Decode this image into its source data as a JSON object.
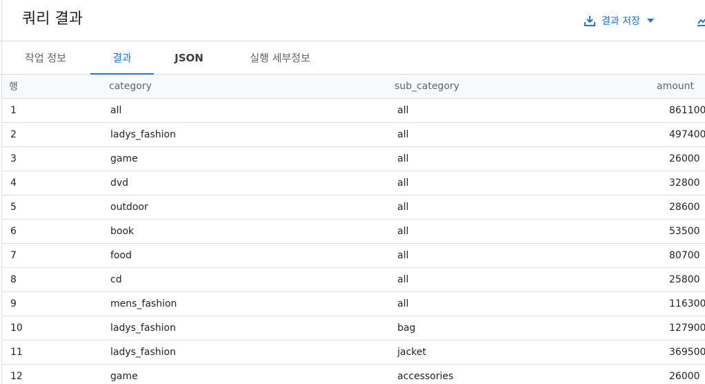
{
  "header": {
    "title": "쿼리 결과",
    "save_results_label": "결과 저장",
    "icons": {
      "save": "download-icon",
      "dropdown": "caret-down-icon",
      "explore": "explore-chart-icon"
    }
  },
  "tabs": [
    {
      "label": "작업 정보",
      "active": false
    },
    {
      "label": "결과",
      "active": true
    },
    {
      "label": "JSON",
      "active": false
    },
    {
      "label": "실행 세부정보",
      "active": false
    }
  ],
  "table": {
    "columns": [
      "행",
      "category",
      "sub_category",
      "amount"
    ],
    "rows": [
      [
        "1",
        "all",
        "all",
        "861100"
      ],
      [
        "2",
        "ladys_fashion",
        "all",
        "497400"
      ],
      [
        "3",
        "game",
        "all",
        "26000"
      ],
      [
        "4",
        "dvd",
        "all",
        "32800"
      ],
      [
        "5",
        "outdoor",
        "all",
        "28600"
      ],
      [
        "6",
        "book",
        "all",
        "53500"
      ],
      [
        "7",
        "food",
        "all",
        "80700"
      ],
      [
        "8",
        "cd",
        "all",
        "25800"
      ],
      [
        "9",
        "mens_fashion",
        "all",
        "116300"
      ],
      [
        "10",
        "ladys_fashion",
        "bag",
        "127900"
      ],
      [
        "11",
        "ladys_fashion",
        "jacket",
        "369500"
      ],
      [
        "12",
        "game",
        "accessories",
        "26000"
      ]
    ]
  },
  "colors": {
    "accent": "#1a73e8",
    "border": "#dadce0",
    "header_bg": "#f8f9fa",
    "text": "#202124",
    "muted_text": "#5f6368"
  }
}
